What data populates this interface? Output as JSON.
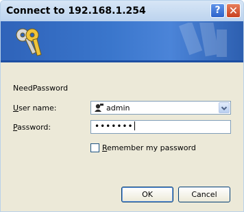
{
  "window": {
    "title": "Connect to 192.168.1.254",
    "help_glyph": "?",
    "close_glyph": "✕"
  },
  "banner": {
    "icon": "keys-icon",
    "watermark": "keys-watermark"
  },
  "form": {
    "message": "NeedPassword",
    "username_label": "User name:",
    "username_label_mnemonic": "U",
    "username_label_rest": "ser name:",
    "username_value": "admin",
    "password_label_mnemonic": "P",
    "password_label_rest": "assword:",
    "password_value": "•••••••",
    "remember_mnemonic": "R",
    "remember_rest": "emember my password",
    "remember_checked": false
  },
  "buttons": {
    "ok": "OK",
    "cancel": "Cancel"
  }
}
